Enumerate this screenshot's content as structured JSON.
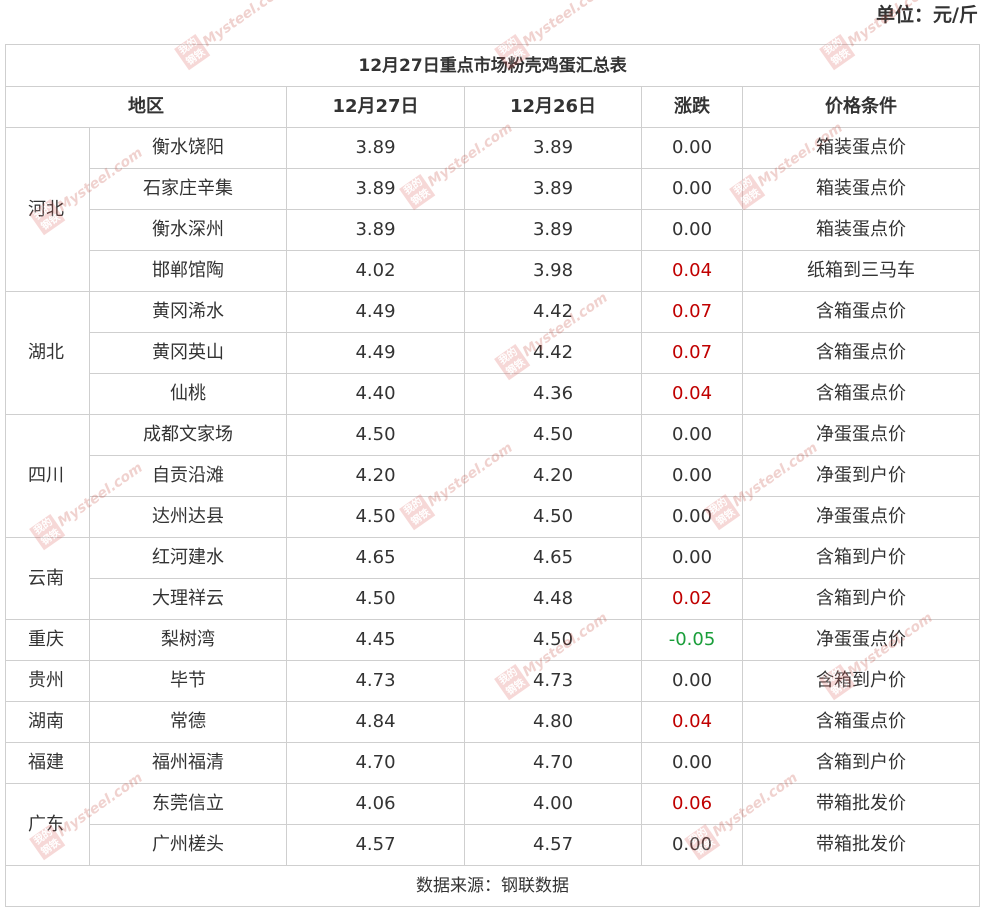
{
  "unit_label": "单位：元/斤",
  "table_title": "12月27日重点市场粉壳鸡蛋汇总表",
  "headers": [
    "地区",
    "12月27日",
    "12月26日",
    "涨跌",
    "价格条件"
  ],
  "groups": [
    {
      "region": "河北",
      "rows": [
        {
          "market": "衡水饶阳",
          "d27": "3.89",
          "d26": "3.89",
          "change": "0.00",
          "trend": "flat",
          "condition": "箱装蛋点价"
        },
        {
          "market": "石家庄辛集",
          "d27": "3.89",
          "d26": "3.89",
          "change": "0.00",
          "trend": "flat",
          "condition": "箱装蛋点价"
        },
        {
          "market": "衡水深州",
          "d27": "3.89",
          "d26": "3.89",
          "change": "0.00",
          "trend": "flat",
          "condition": "箱装蛋点价"
        },
        {
          "market": "邯郸馆陶",
          "d27": "4.02",
          "d26": "3.98",
          "change": "0.04",
          "trend": "up",
          "condition": "纸箱到三马车"
        }
      ]
    },
    {
      "region": "湖北",
      "rows": [
        {
          "market": "黄冈浠水",
          "d27": "4.49",
          "d26": "4.42",
          "change": "0.07",
          "trend": "up",
          "condition": "含箱蛋点价"
        },
        {
          "market": "黄冈英山",
          "d27": "4.49",
          "d26": "4.42",
          "change": "0.07",
          "trend": "up",
          "condition": "含箱蛋点价"
        },
        {
          "market": "仙桃",
          "d27": "4.40",
          "d26": "4.36",
          "change": "0.04",
          "trend": "up",
          "condition": "含箱蛋点价"
        }
      ]
    },
    {
      "region": "四川",
      "rows": [
        {
          "market": "成都文家场",
          "d27": "4.50",
          "d26": "4.50",
          "change": "0.00",
          "trend": "flat",
          "condition": "净蛋蛋点价"
        },
        {
          "market": "自贡沿滩",
          "d27": "4.20",
          "d26": "4.20",
          "change": "0.00",
          "trend": "flat",
          "condition": "净蛋到户价"
        },
        {
          "market": "达州达县",
          "d27": "4.50",
          "d26": "4.50",
          "change": "0.00",
          "trend": "flat",
          "condition": "净蛋蛋点价"
        }
      ]
    },
    {
      "region": "云南",
      "rows": [
        {
          "market": "红河建水",
          "d27": "4.65",
          "d26": "4.65",
          "change": "0.00",
          "trend": "flat",
          "condition": "含箱到户价"
        },
        {
          "market": "大理祥云",
          "d27": "4.50",
          "d26": "4.48",
          "change": "0.02",
          "trend": "up",
          "condition": "含箱到户价"
        }
      ]
    },
    {
      "region": "重庆",
      "rows": [
        {
          "market": "梨树湾",
          "d27": "4.45",
          "d26": "4.50",
          "change": "-0.05",
          "trend": "down",
          "condition": "净蛋蛋点价"
        }
      ]
    },
    {
      "region": "贵州",
      "rows": [
        {
          "market": "毕节",
          "d27": "4.73",
          "d26": "4.73",
          "change": "0.00",
          "trend": "flat",
          "condition": "含箱到户价"
        }
      ]
    },
    {
      "region": "湖南",
      "rows": [
        {
          "market": "常德",
          "d27": "4.84",
          "d26": "4.80",
          "change": "0.04",
          "trend": "up",
          "condition": "含箱蛋点价"
        }
      ]
    },
    {
      "region": "福建",
      "rows": [
        {
          "market": "福州福清",
          "d27": "4.70",
          "d26": "4.70",
          "change": "0.00",
          "trend": "flat",
          "condition": "含箱到户价"
        }
      ]
    },
    {
      "region": "广东",
      "rows": [
        {
          "market": "东莞信立",
          "d27": "4.06",
          "d26": "4.00",
          "change": "0.06",
          "trend": "up",
          "condition": "带箱批发价"
        },
        {
          "market": "广州槎头",
          "d27": "4.57",
          "d26": "4.57",
          "change": "0.00",
          "trend": "flat",
          "condition": "带箱批发价"
        }
      ]
    }
  ],
  "source": "数据来源：钢联数据",
  "watermark": {
    "stamp": "我的钢铁",
    "brand": "Mysteel.com"
  },
  "colors": {
    "up": "#c00000",
    "down": "#1a9e3a",
    "border": "#cfcfcf"
  }
}
